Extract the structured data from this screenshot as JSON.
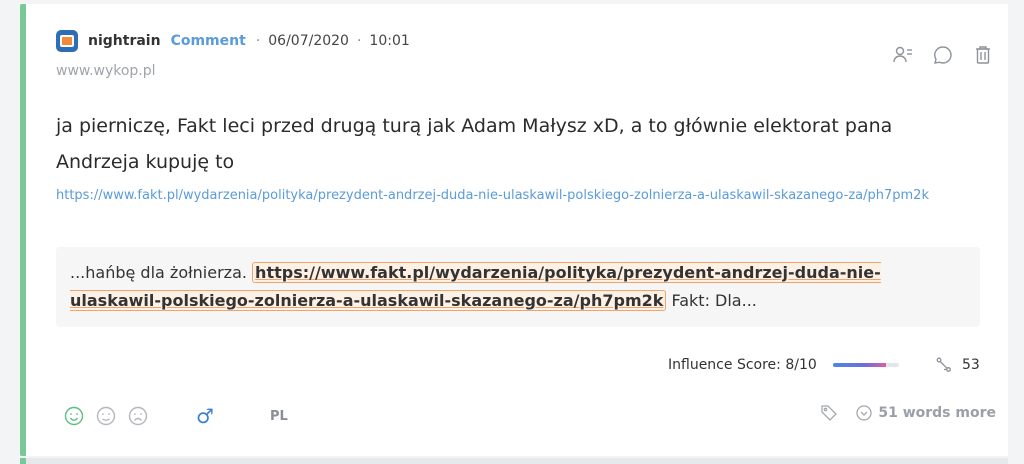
{
  "post": {
    "author": "nightrain",
    "type": "Comment",
    "date": "06/07/2020",
    "time": "10:01",
    "separator": "·",
    "site": "www.wykop.pl",
    "text": "ja pierniczę, Fakt leci przed drugą turą jak Adam Małysz xD, a to głównie elektorat pana Andrzeja kupuję to",
    "link": "https://www.fakt.pl/wydarzenia/polityka/prezydent-andrzej-duda-nie-ulaskawil-polskiego-zolnierza-a-ulaskawil-skazanego-za/ph7pm2k"
  },
  "quote": {
    "before": "...hańbę dla żołnierza.",
    "highlight": "https://www.fakt.pl/wydarzenia/polityka/prezydent-andrzej-duda-nie-ulaskawil-polskiego-zolnierza-a-ulaskawil-skazanego-za/ph7pm2k",
    "after": "Fakt: Dla..."
  },
  "metrics": {
    "influence_label": "Influence Score: 8/10",
    "influence_fraction": 0.8,
    "reach": "53"
  },
  "footer": {
    "gender_symbol": "♂",
    "language": "PL",
    "more_label": "51 words more"
  },
  "colors": {
    "accent_border": "#79c998",
    "link": "#5a9bdc",
    "highlight_border": "#f0a46b"
  },
  "icons": [
    "wykop-source-icon",
    "user-list-icon",
    "comment-icon",
    "trash-icon",
    "positive-sentiment-icon",
    "neutral-sentiment-icon",
    "negative-sentiment-icon",
    "male-icon",
    "tag-icon",
    "chevron-down-circle-icon",
    "reach-icon"
  ]
}
